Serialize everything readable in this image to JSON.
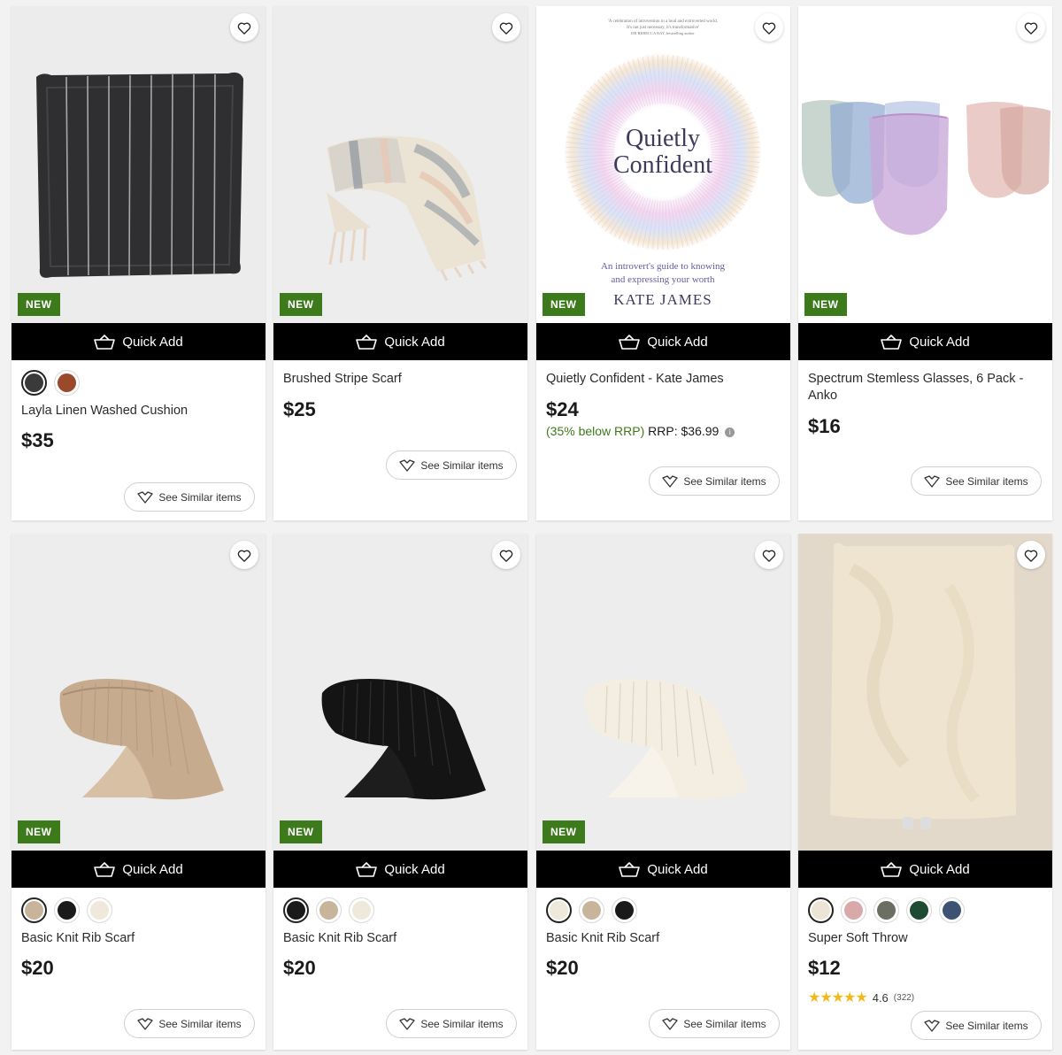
{
  "common": {
    "quick_add_label": "Quick Add",
    "see_similar_label": "See Similar items",
    "new_badge": "NEW"
  },
  "products": [
    {
      "title": "Layla Linen Washed Cushion",
      "price": "$35",
      "badge": "NEW",
      "swatches": [
        {
          "color": "#3a3a3a",
          "selected": true
        },
        {
          "color": "#9a4a2a",
          "selected": false
        }
      ]
    },
    {
      "title": "Brushed Stripe Scarf",
      "price": "$25",
      "badge": "NEW",
      "swatches": []
    },
    {
      "title": "Quietly Confident - Kate James",
      "price": "$24",
      "badge": "NEW",
      "discount": "(35% below RRP)",
      "rrp": "RRP: $36.99",
      "swatches": [],
      "cover": {
        "blurb_line1": "'A celebration of introversion in a loud and extroverted world.",
        "blurb_line2": "It's not just necessary, it's transformative'",
        "blurb_line3": "DR REBECCA RAY, bestselling author",
        "title_line1": "Quietly",
        "title_line2": "Confident",
        "subtitle_line1": "An introvert's guide to knowing",
        "subtitle_line2": "and expressing your worth",
        "author": "KATE JAMES"
      }
    },
    {
      "title": "Spectrum Stemless Glasses, 6 Pack - Anko",
      "price": "$16",
      "badge": "NEW",
      "swatches": []
    },
    {
      "title": "Basic Knit Rib Scarf",
      "price": "$20",
      "badge": "NEW",
      "swatches": [
        {
          "color": "#c8b49a",
          "selected": true
        },
        {
          "color": "#1a1a1a",
          "selected": false
        },
        {
          "color": "#efe9dc",
          "selected": false
        }
      ]
    },
    {
      "title": "Basic Knit Rib Scarf",
      "price": "$20",
      "badge": "NEW",
      "swatches": [
        {
          "color": "#1a1a1a",
          "selected": true
        },
        {
          "color": "#c8b49a",
          "selected": false
        },
        {
          "color": "#efe9dc",
          "selected": false
        }
      ]
    },
    {
      "title": "Basic Knit Rib Scarf",
      "price": "$20",
      "badge": "NEW",
      "swatches": [
        {
          "color": "#efe9dc",
          "selected": true
        },
        {
          "color": "#c8b49a",
          "selected": false
        },
        {
          "color": "#1a1a1a",
          "selected": false
        }
      ]
    },
    {
      "title": "Super Soft Throw",
      "price": "$12",
      "rating": "4.6",
      "rating_count": "(322)",
      "rating_value": 4.6,
      "swatches": [
        {
          "color": "#ece5d6",
          "selected": true
        },
        {
          "color": "#d9a9a9",
          "selected": false
        },
        {
          "color": "#6b6e62",
          "selected": false
        },
        {
          "color": "#1f4a34",
          "selected": false
        },
        {
          "color": "#3e5273",
          "selected": false
        }
      ]
    }
  ]
}
